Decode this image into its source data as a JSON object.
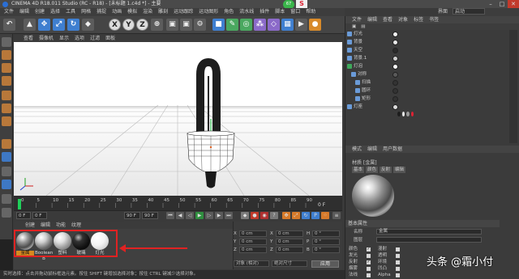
{
  "window": {
    "title": "CINEMA 4D R18.011 Studio (RC - R18) - [未标题 1.c4d *] - 主要",
    "net_badge": "67",
    "s_badge": "S"
  },
  "menubar": {
    "items": [
      "文件",
      "编辑",
      "创建",
      "选择",
      "工具",
      "网格",
      "捕捉",
      "动画",
      "模拟",
      "渲染",
      "雕刻",
      "运动跟踪",
      "运动图形",
      "角色",
      "流水线",
      "插件",
      "脚本",
      "窗口",
      "帮助"
    ]
  },
  "layout": {
    "label": "界面",
    "value": "启动"
  },
  "toolbar": {
    "x_label": "X",
    "y_label": "Y",
    "z_label": "Z"
  },
  "viewport": {
    "menu": [
      "查看",
      "摄像机",
      "显示",
      "选项",
      "过滤",
      "面板"
    ]
  },
  "timeline": {
    "ticks": [
      "0",
      "5",
      "10",
      "15",
      "20",
      "25",
      "30",
      "35",
      "40",
      "45",
      "50",
      "55",
      "60",
      "65",
      "70",
      "75",
      "80",
      "85",
      "90"
    ],
    "end_frame": "0 F",
    "start_field": "0 F",
    "min_field": "0 F",
    "max_field": "90 F",
    "max_field2": "90 F"
  },
  "material_manager": {
    "menu": [
      "创建",
      "编辑",
      "功能",
      "纹理"
    ],
    "materials": [
      {
        "label": "金属"
      },
      {
        "label": "Boolean B"
      },
      {
        "label": "塑料"
      },
      {
        "label": "玻璃"
      },
      {
        "label": "灯光"
      }
    ]
  },
  "coordinates": {
    "rows": [
      {
        "a": "X",
        "av": "0 cm",
        "b": "X",
        "bv": "0 cm",
        "c": "H",
        "cv": "0 °"
      },
      {
        "a": "Y",
        "av": "0 cm",
        "b": "Y",
        "bv": "0 cm",
        "c": "P",
        "cv": "0 °"
      },
      {
        "a": "Z",
        "av": "0 cm",
        "b": "Z",
        "bv": "0 cm",
        "c": "B",
        "cv": "0 °"
      }
    ],
    "mode_select": "对象 (相对)",
    "size_select": "绝对尺寸",
    "apply_label": "应用"
  },
  "statusbar": {
    "text": "实时选择：点击并拖动鼠标框选元素。按住 SHIFT 键增加选择对象；按住 CTRL 键减少选择对象。"
  },
  "object_manager": {
    "tabs": [
      "文件",
      "编辑",
      "查看",
      "对象",
      "标签",
      "书签"
    ],
    "objects": [
      {
        "name": "灯光",
        "indent": 0
      },
      {
        "name": "背景",
        "indent": 0
      },
      {
        "name": "天空",
        "indent": 0
      },
      {
        "name": "背景.1",
        "indent": 0
      },
      {
        "name": "灯泡",
        "indent": 0
      },
      {
        "name": "对称",
        "indent": 1
      },
      {
        "name": "扫描",
        "indent": 2
      },
      {
        "name": "圆环",
        "indent": 2
      },
      {
        "name": "矩形",
        "indent": 2
      },
      {
        "name": "灯座",
        "indent": 0
      }
    ]
  },
  "attributes": {
    "tabs": [
      "模式",
      "编辑",
      "用户数据"
    ],
    "menu": [
      "模式",
      "编辑",
      "用户数据"
    ],
    "material_title": "材质 [金属]",
    "material_tabs": [
      "基本",
      "颜色",
      "反射",
      "编辑"
    ],
    "section": "基本属性",
    "name_label": "名称",
    "name_value": "金属",
    "layer_label": "图层",
    "channels": [
      {
        "label": "颜色",
        "checked": true
      },
      {
        "label": "漫射",
        "checked": false
      },
      {
        "label": "发光",
        "checked": false
      },
      {
        "label": "透明",
        "checked": false
      },
      {
        "label": "反射",
        "checked": true
      },
      {
        "label": "环境",
        "checked": false
      },
      {
        "label": "烟雾",
        "checked": false
      },
      {
        "label": "凹凸",
        "checked": false
      },
      {
        "label": "法线",
        "checked": false
      },
      {
        "label": "Alpha",
        "checked": false
      }
    ]
  },
  "watermark": "头条 @霜小付"
}
